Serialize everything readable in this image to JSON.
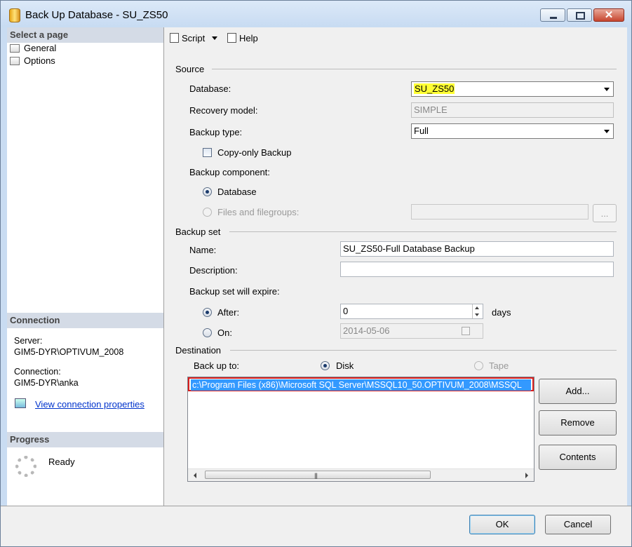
{
  "window": {
    "title": "Back Up Database - SU_ZS50"
  },
  "left_pane": {
    "select_page_header": "Select a page",
    "pages": [
      "General",
      "Options"
    ],
    "connection_header": "Connection",
    "server_label": "Server:",
    "server_value": "GIM5-DYR\\OPTIVUM_2008",
    "connection_label": "Connection:",
    "connection_value": "GIM5-DYR\\anka",
    "view_connection_link": "View connection properties",
    "progress_header": "Progress",
    "progress_status": "Ready"
  },
  "toolbar": {
    "script_label": "Script",
    "help_label": "Help"
  },
  "source": {
    "group_label": "Source",
    "database_label": "Database:",
    "database_value": "SU_ZS50",
    "recovery_model_label": "Recovery model:",
    "recovery_model_value": "SIMPLE",
    "backup_type_label": "Backup type:",
    "backup_type_value": "Full",
    "copy_only_label": "Copy-only Backup",
    "copy_only_checked": false,
    "backup_component_label": "Backup component:",
    "component_database_label": "Database",
    "component_files_label": "Files and filegroups:",
    "browse_label": "...",
    "selected_component": "Database"
  },
  "backup_set": {
    "group_label": "Backup set",
    "name_label": "Name:",
    "name_value": "SU_ZS50-Full Database Backup",
    "description_label": "Description:",
    "description_value": "",
    "expire_label": "Backup set will expire:",
    "after_label": "After:",
    "after_value": "0",
    "days_label": "days",
    "on_label": "On:",
    "on_value": "2014-05-06",
    "selected_expire": "After"
  },
  "destination": {
    "group_label": "Destination",
    "backup_to_label": "Back up to:",
    "disk_label": "Disk",
    "tape_label": "Tape",
    "selected_media": "Disk",
    "paths": [
      "c:\\Program Files (x86)\\Microsoft SQL Server\\MSSQL10_50.OPTIVUM_2008\\MSSQL"
    ],
    "add_label": "Add...",
    "remove_label": "Remove",
    "contents_label": "Contents"
  },
  "footer": {
    "ok_label": "OK",
    "cancel_label": "Cancel"
  },
  "colors": {
    "highlight": "#ffff33",
    "selection": "#3399ff",
    "selection_border": "#d81e1e",
    "link": "#0033cc"
  }
}
